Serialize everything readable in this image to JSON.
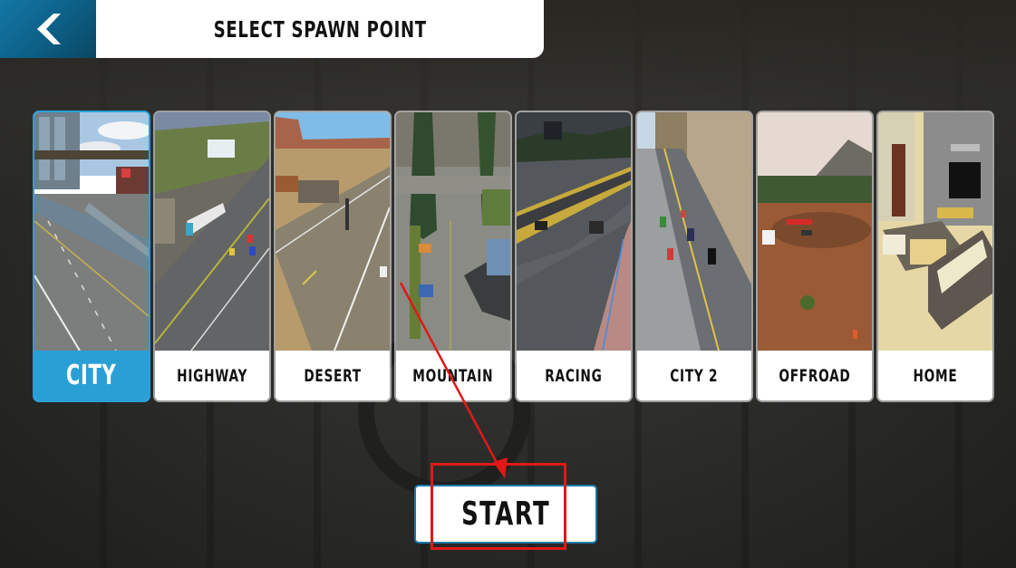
{
  "header": {
    "back_icon": "chevron-left-icon",
    "title": "SELECT SPAWN POINT"
  },
  "spawn_points": [
    {
      "label": "CITY",
      "selected": true,
      "scene": "city street with overpass and buildings"
    },
    {
      "label": "HIGHWAY",
      "selected": false,
      "scene": "multi-lane highway with truck and cars"
    },
    {
      "label": "DESERT",
      "selected": false,
      "scene": "desert road with mesa and drag-race tree"
    },
    {
      "label": "MOUNTAIN",
      "selected": false,
      "scene": "mountain town intersection with pine trees"
    },
    {
      "label": "RACING",
      "selected": false,
      "scene": "race track start line with barriers"
    },
    {
      "label": "CITY 2",
      "selected": false,
      "scene": "downtown avenue with traffic"
    },
    {
      "label": "OFFROAD",
      "selected": false,
      "scene": "dirt offroad track with mountain"
    },
    {
      "label": "HOME",
      "selected": false,
      "scene": "living room interior with sofa and TV"
    }
  ],
  "start_button": {
    "label": "START"
  },
  "annotation": {
    "color": "#e01818",
    "target": "start-button"
  },
  "colors": {
    "accent_blue": "#2a9fd6",
    "back_button_blue": "#0c5f85",
    "start_border": "#1a78a8"
  }
}
